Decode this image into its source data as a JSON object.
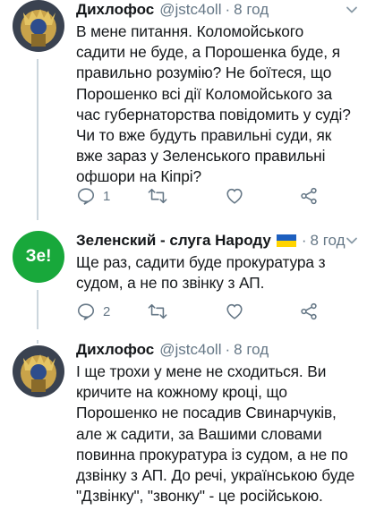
{
  "tweets": [
    {
      "author": "Дихлофос",
      "handle": "@jstc4oll",
      "dot": "·",
      "time": "8 год",
      "text": "В мене питання. Коломойського садити не буде, а Порошенка буде, я правильно розумію? Не боїтеся, що Порошенко всі дії Коломойського за час губернаторства повідомить у суді? Чи то вже будуть правильні суди, як вже зараз у Зеленського правильні офшори на Кіпрі?",
      "reply_count": "1",
      "retweet_count": "",
      "like_count": ""
    },
    {
      "author": "Зеленский - слуга Народу",
      "avatar_text": "Зе!",
      "dot": "·",
      "time": "8 год",
      "text": "Ще раз, садити буде прокуратура з судом, а не по звінку з АП.",
      "reply_count": "2",
      "retweet_count": "",
      "like_count": ""
    },
    {
      "author": "Дихлофос",
      "handle": "@jstc4oll",
      "dot": "·",
      "time": "8 год",
      "text": "І ще трохи у мене не сходиться. Ви кричите на кожному кроці, що Порошенко не посадив Свинарчуків, але ж садити, за Вашими словами повинна прокуратура із судом, а не по дзвінку з АП. До речі, українською буде \"Дзвінку\", \"звонку\" - це російською."
    }
  ],
  "icons": {
    "reply": "reply-icon",
    "retweet": "retweet-icon",
    "like": "heart-icon",
    "share": "share-icon",
    "more": "chevron-down-icon",
    "flag": "ukraine-flag-icon"
  },
  "colors": {
    "text": "#14171a",
    "muted": "#657786",
    "thread_line": "#ccd6dd",
    "ze_green": "#18a83b"
  }
}
